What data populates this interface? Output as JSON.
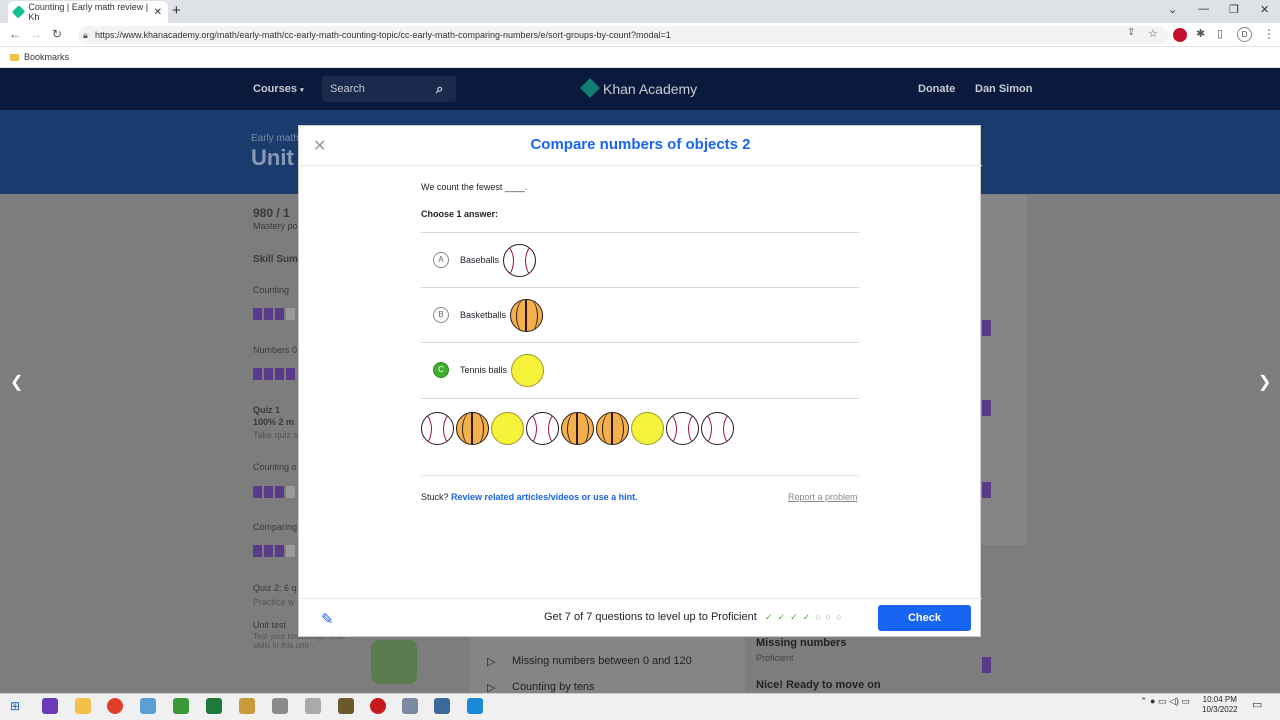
{
  "browser": {
    "tab_title": "Counting | Early math review | Kh",
    "tab_close": "✕",
    "new_tab": "+",
    "url": "https://www.khanacademy.org/math/early-math/cc-early-math-counting-topic/cc-early-math-comparing-numbers/e/sort-groups-by-count?modal=1",
    "bookmarks_label": "Bookmarks",
    "profile_initial": "D"
  },
  "ka_header": {
    "courses": "Courses",
    "search_placeholder": "Search",
    "logo": "Khan Academy",
    "donate": "Donate",
    "user": "Dan Simon"
  },
  "background_page": {
    "breadcrumb": "Early math",
    "unit_title": "Unit",
    "points": "980 / 1",
    "mastery": "Mastery po",
    "skill_summary": "Skill Sum",
    "counting": "Counting",
    "numbers": "Numbers 0",
    "quiz1": "Quiz 1",
    "quiz1_score": "100% 2 m",
    "quiz1_sub": "Take quiz a",
    "counting_obj": "Counting o",
    "comparing": "Comparing",
    "quiz2": "Quiz 2: 6 q",
    "quiz2_sub": "Practice w",
    "unit_test": "Unit test",
    "unit_test_sub": "Test your knowledge of all skills in this unit",
    "missing_numbers": "Missing numbers",
    "missing_proficient": "Proficient",
    "missing_between": "Missing numbers between 0 and 120",
    "counting_tens": "Counting by tens",
    "nice_ready": "Nice! Ready to move on"
  },
  "modal": {
    "title": "Compare numbers of objects 2",
    "question": "We count the fewest ____.",
    "instruction": "Choose 1 answer:",
    "choices": [
      {
        "letter": "A",
        "label": "Baseballs",
        "icon": "baseball-icon",
        "selected": false
      },
      {
        "letter": "B",
        "label": "Basketballs",
        "icon": "basketball-icon",
        "selected": false
      },
      {
        "letter": "C",
        "label": "Tennis balls",
        "icon": "tennis-ball-icon",
        "selected": true
      }
    ],
    "ball_row": [
      "baseball",
      "basketball",
      "tennis",
      "baseball",
      "basketball",
      "basketball",
      "tennis",
      "baseball",
      "baseball"
    ],
    "stuck_prefix": "Stuck?",
    "stuck_link": "Review related articles/videos or use a hint.",
    "report": "Report a problem",
    "level_up": "Get 7 of 7 questions to level up to Proficient",
    "check_button": "Check",
    "progress": {
      "done": 4,
      "total": 7
    }
  },
  "taskbar": {
    "time": "10:04 PM",
    "date": "10/3/2022"
  },
  "colors": {
    "ka_blue": "#1865f2",
    "ka_navy": "#0a1a3c",
    "correct_green": "#3fae2a"
  }
}
